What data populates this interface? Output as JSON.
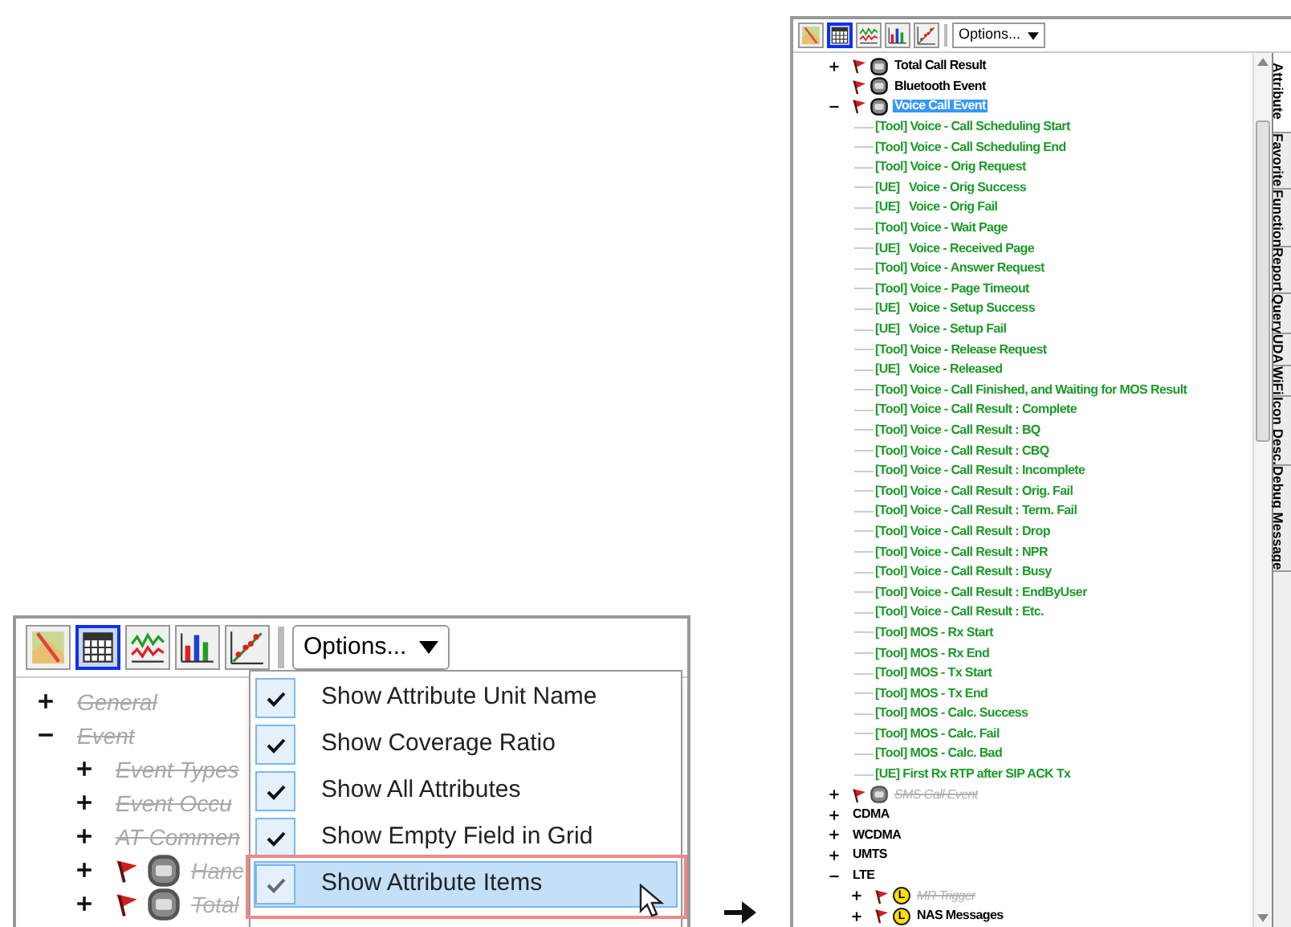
{
  "left_panel": {
    "toolbar": [
      {
        "kind": "map",
        "selected": false
      },
      {
        "kind": "grid",
        "selected": true
      },
      {
        "kind": "line",
        "selected": false
      },
      {
        "kind": "bar",
        "selected": false
      },
      {
        "kind": "scatter",
        "selected": false
      }
    ],
    "options_button": "Options...",
    "tree": [
      {
        "label": "General",
        "kind": "folder",
        "expanded": false,
        "disabled": true,
        "selected": false
      },
      {
        "label": "Event",
        "kind": "folder",
        "expanded": true,
        "disabled": true,
        "selected": false,
        "children": [
          {
            "label": "Event Types",
            "kind": "folder",
            "expanded": false,
            "disabled": true,
            "selected": false
          },
          {
            "label": "Event Occu",
            "kind": "folder",
            "expanded": false,
            "disabled": true,
            "selected": false
          },
          {
            "label": "AT Commen",
            "kind": "folder",
            "expanded": false,
            "disabled": true,
            "selected": false
          },
          {
            "label": "Hanc",
            "kind": "event",
            "expanded": false,
            "disabled": true,
            "selected": false
          },
          {
            "label": "Total",
            "kind": "event",
            "expanded": false,
            "disabled": true,
            "selected": false
          }
        ]
      }
    ],
    "options_menu": [
      {
        "label": "Show Attribute Unit Name",
        "checked": true,
        "selected": false
      },
      {
        "label": "Show Coverage Ratio",
        "checked": true,
        "selected": false
      },
      {
        "label": "Show All Attributes",
        "checked": true,
        "selected": false
      },
      {
        "label": "Show Empty Field in Grid",
        "checked": true,
        "selected": false
      },
      {
        "label": "Show Attribute Items",
        "checked": true,
        "selected": true
      }
    ]
  },
  "right_panel": {
    "toolbar": [
      {
        "kind": "map",
        "selected": false
      },
      {
        "kind": "grid",
        "selected": true
      },
      {
        "kind": "line",
        "selected": false
      },
      {
        "kind": "bar",
        "selected": false
      },
      {
        "kind": "scatter",
        "selected": false
      }
    ],
    "options_button": "Options...",
    "tree": [
      {
        "label": "Total Call Result",
        "kind": "event",
        "expanded": false,
        "disabled": false,
        "selected": false
      },
      {
        "label": "Bluetooth Event",
        "kind": "event",
        "disabled": false,
        "selected": false
      },
      {
        "label": "Voice Call Event",
        "kind": "event",
        "expanded": true,
        "disabled": false,
        "selected": true,
        "children": [
          {
            "label": "[Tool] Voice - Call Scheduling Start",
            "kind": "leaf",
            "selected": false
          },
          {
            "label": "[Tool] Voice - Call Scheduling End",
            "kind": "leaf",
            "selected": false
          },
          {
            "label": "[Tool] Voice - Orig Request",
            "kind": "leaf",
            "selected": false
          },
          {
            "label": "[UE]   Voice - Orig Success",
            "kind": "leaf",
            "selected": false
          },
          {
            "label": "[UE]   Voice - Orig Fail",
            "kind": "leaf",
            "selected": false
          },
          {
            "label": "[Tool] Voice - Wait Page",
            "kind": "leaf",
            "selected": false
          },
          {
            "label": "[UE]   Voice - Received Page",
            "kind": "leaf",
            "selected": false
          },
          {
            "label": "[Tool] Voice - Answer Request",
            "kind": "leaf",
            "selected": false
          },
          {
            "label": "[Tool] Voice - Page Timeout",
            "kind": "leaf",
            "selected": false
          },
          {
            "label": "[UE]   Voice - Setup Success",
            "kind": "leaf",
            "selected": false
          },
          {
            "label": "[UE]   Voice - Setup Fail",
            "kind": "leaf",
            "selected": false
          },
          {
            "label": "[Tool] Voice - Release Request",
            "kind": "leaf",
            "selected": false
          },
          {
            "label": "[UE]   Voice - Released",
            "kind": "leaf",
            "selected": false
          },
          {
            "label": "[Tool] Voice - Call Finished, and Waiting for MOS Result",
            "kind": "leaf",
            "selected": false
          },
          {
            "label": "[Tool] Voice - Call Result : Complete",
            "kind": "leaf",
            "selected": false
          },
          {
            "label": "[Tool] Voice - Call Result : BQ",
            "kind": "leaf",
            "selected": false
          },
          {
            "label": "[Tool] Voice - Call Result : CBQ",
            "kind": "leaf",
            "selected": false
          },
          {
            "label": "[Tool] Voice - Call Result : Incomplete",
            "kind": "leaf",
            "selected": false
          },
          {
            "label": "[Tool] Voice - Call Result : Orig. Fail",
            "kind": "leaf",
            "selected": false
          },
          {
            "label": "[Tool] Voice - Call Result : Term. Fail",
            "kind": "leaf",
            "selected": false
          },
          {
            "label": "[Tool] Voice - Call Result : Drop",
            "kind": "leaf",
            "selected": false
          },
          {
            "label": "[Tool] Voice - Call Result : NPR",
            "kind": "leaf",
            "selected": false
          },
          {
            "label": "[Tool] Voice - Call Result : Busy",
            "kind": "leaf",
            "selected": false
          },
          {
            "label": "[Tool] Voice - Call Result : EndByUser",
            "kind": "leaf",
            "selected": false
          },
          {
            "label": "[Tool] Voice - Call Result : Etc.",
            "kind": "leaf",
            "selected": false
          },
          {
            "label": "[Tool] MOS - Rx Start",
            "kind": "leaf",
            "selected": false
          },
          {
            "label": "[Tool] MOS - Rx End",
            "kind": "leaf",
            "selected": false
          },
          {
            "label": "[Tool] MOS - Tx Start",
            "kind": "leaf",
            "selected": false
          },
          {
            "label": "[Tool] MOS - Tx End",
            "kind": "leaf",
            "selected": false
          },
          {
            "label": "[Tool] MOS - Calc. Success",
            "kind": "leaf",
            "selected": false
          },
          {
            "label": "[Tool] MOS - Calc. Fail",
            "kind": "leaf",
            "selected": false
          },
          {
            "label": "[Tool] MOS - Calc. Bad",
            "kind": "leaf",
            "selected": false
          },
          {
            "label": "[UE] First Rx RTP after SIP ACK Tx",
            "kind": "leaf",
            "selected": false
          }
        ]
      },
      {
        "label": "SMS Call Event",
        "kind": "event",
        "expanded": false,
        "disabled": true,
        "selected": false
      },
      {
        "label": "CDMA",
        "kind": "folder",
        "expanded": false,
        "disabled": false,
        "selected": false
      },
      {
        "label": "WCDMA",
        "kind": "folder",
        "expanded": false,
        "disabled": false,
        "selected": false
      },
      {
        "label": "UMTS",
        "kind": "folder",
        "expanded": false,
        "disabled": false,
        "selected": false
      },
      {
        "label": "LTE",
        "kind": "folder",
        "expanded": true,
        "disabled": false,
        "selected": false,
        "children": [
          {
            "label": "MR Trigger",
            "kind": "lte",
            "badge": "L",
            "expanded": false,
            "disabled": true,
            "selected": false
          },
          {
            "label": "NAS Messages",
            "kind": "lte",
            "badge": "L",
            "expanded": false,
            "disabled": false,
            "selected": false
          }
        ]
      }
    ],
    "side_tabs": [
      {
        "label": "Attribute",
        "selected": true
      },
      {
        "label": "Favorite",
        "selected": false
      },
      {
        "label": "Function",
        "selected": false
      },
      {
        "label": "Report",
        "selected": false
      },
      {
        "label": "Query",
        "selected": false
      },
      {
        "label": "UDA",
        "selected": false
      },
      {
        "label": "WiFi",
        "selected": false
      },
      {
        "label": "Icon Desc.",
        "selected": false
      },
      {
        "label": "Debug Message",
        "selected": false
      }
    ]
  }
}
